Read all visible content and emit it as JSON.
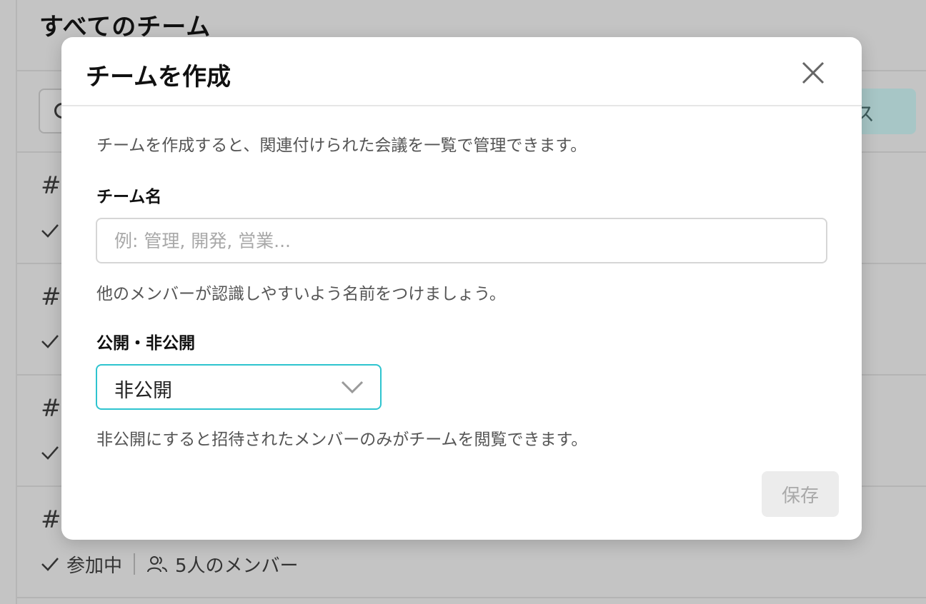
{
  "background": {
    "page_title": "すべてのチーム",
    "search_button_fragment": "ス",
    "team_rows": [
      {
        "hash": "#"
      },
      {
        "hash": "#a"
      },
      {
        "hash": "#"
      },
      {
        "hash": "#"
      }
    ],
    "last_row": {
      "joined_label": "参加中",
      "member_count_label": "5人のメンバー"
    }
  },
  "modal": {
    "title": "チームを作成",
    "description": "チームを作成すると、関連付けられた会議を一覧で管理できます。",
    "team_name": {
      "label": "チーム名",
      "value": "",
      "placeholder": "例: 管理, 開発, 営業...",
      "help": "他のメンバーが認識しやすいよう名前をつけましょう。"
    },
    "visibility": {
      "label": "公開・非公開",
      "selected": "非公開",
      "help": "非公開にすると招待されたメンバーのみがチームを閲覧できます。"
    },
    "save_label": "保存"
  },
  "colors": {
    "accent_border": "#2ec4cf",
    "overlay": "#c4c4c4",
    "disabled_button": "#ececec"
  }
}
